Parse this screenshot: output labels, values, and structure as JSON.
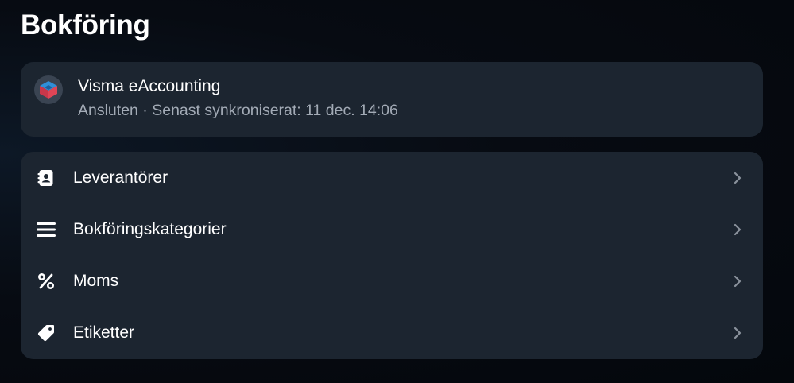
{
  "page": {
    "title": "Bokföring"
  },
  "integration": {
    "name": "Visma eAccounting",
    "status": "Ansluten · Senast synkroniserat: 11 dec. 14:06",
    "logo_icon": "visma-logo-icon"
  },
  "menu": {
    "items": [
      {
        "label": "Leverantörer",
        "icon": "contact-book-icon"
      },
      {
        "label": "Bokföringskategorier",
        "icon": "list-icon"
      },
      {
        "label": "Moms",
        "icon": "percent-icon"
      },
      {
        "label": "Etiketter",
        "icon": "tag-icon"
      }
    ]
  },
  "colors": {
    "background": "#070b12",
    "card": "#1c2530",
    "text_primary": "#ffffff",
    "text_secondary": "#a3abb6",
    "chevron": "#8a929c",
    "logo_blue": "#2f8fd8",
    "logo_red": "#d83a4a"
  }
}
